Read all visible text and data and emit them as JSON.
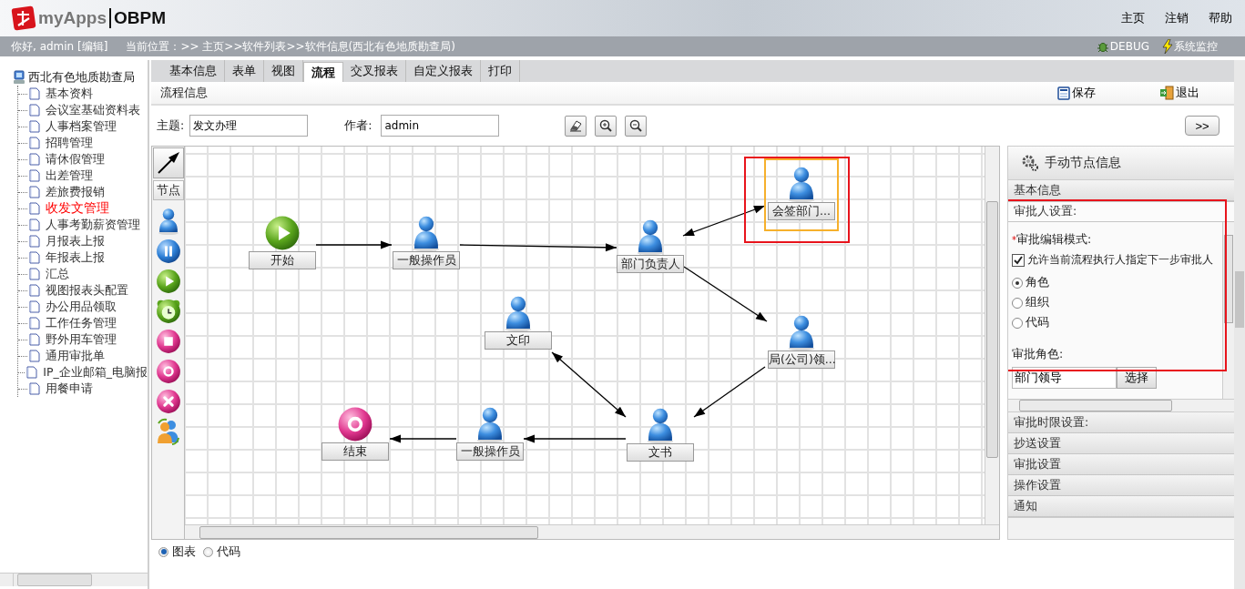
{
  "header": {
    "logo_text": "myApps",
    "product": "OBPM",
    "links": [
      "主页",
      "注销",
      "帮助"
    ]
  },
  "info_bar": {
    "greeting": "你好, admin [编辑]",
    "location": "当前位置：>> 主页>>软件列表>>软件信息(西北有色地质勘查局)",
    "tools": [
      {
        "kind": "debug",
        "label": "DEBUG"
      },
      {
        "kind": "monitor",
        "label": "系统监控"
      }
    ]
  },
  "sidebar": {
    "root": "西北有色地质勘查局",
    "items": [
      {
        "label": "基本资料",
        "selected": false
      },
      {
        "label": "会议室基础资料表",
        "selected": false
      },
      {
        "label": "人事档案管理",
        "selected": false
      },
      {
        "label": "招聘管理",
        "selected": false
      },
      {
        "label": "请休假管理",
        "selected": false
      },
      {
        "label": "出差管理",
        "selected": false
      },
      {
        "label": "差旅费报销",
        "selected": false
      },
      {
        "label": "收发文管理",
        "selected": true
      },
      {
        "label": "人事考勤薪资管理",
        "selected": false
      },
      {
        "label": "月报表上报",
        "selected": false
      },
      {
        "label": "年报表上报",
        "selected": false
      },
      {
        "label": "汇总",
        "selected": false
      },
      {
        "label": "视图报表头配置",
        "selected": false
      },
      {
        "label": "办公用品领取",
        "selected": false
      },
      {
        "label": "工作任务管理",
        "selected": false
      },
      {
        "label": "野外用车管理",
        "selected": false
      },
      {
        "label": "通用审批单",
        "selected": false
      },
      {
        "label": "IP_企业邮箱_电脑报",
        "selected": false
      },
      {
        "label": "用餐申请",
        "selected": false
      }
    ]
  },
  "tabs": [
    {
      "label": "基本信息",
      "selected": false
    },
    {
      "label": "表单",
      "selected": false
    },
    {
      "label": "视图",
      "selected": false
    },
    {
      "label": "流程",
      "selected": true
    },
    {
      "label": "交叉报表",
      "selected": false
    },
    {
      "label": "自定义报表",
      "selected": false
    },
    {
      "label": "打印",
      "selected": false
    }
  ],
  "toolbar": {
    "title": "流程信息",
    "buttons": [
      {
        "kind": "save",
        "label": "保存"
      },
      {
        "kind": "exit",
        "label": "退出"
      }
    ]
  },
  "form": {
    "subject_label": "主题:",
    "subject": "发文办理",
    "author_label": "作者:",
    "author": "admin",
    "expand_button": ">>"
  },
  "palette": {
    "label": "节点",
    "tools": [
      {
        "kind": "person"
      },
      {
        "kind": "suspend"
      },
      {
        "kind": "start"
      },
      {
        "kind": "timer"
      },
      {
        "kind": "stop"
      },
      {
        "kind": "end"
      },
      {
        "kind": "abort"
      },
      {
        "kind": "auto"
      }
    ]
  },
  "diagram": {
    "nodes": [
      {
        "label": "会签部门...",
        "kind": "person",
        "selected": true
      },
      {
        "label": "开始",
        "kind": "start",
        "selected": false
      },
      {
        "label": "一般操作员",
        "kind": "person",
        "selected": false
      },
      {
        "label": "部门负责人",
        "kind": "person",
        "selected": false
      },
      {
        "label": "文印",
        "kind": "person",
        "selected": false
      },
      {
        "label": "局(公司)领...",
        "kind": "person",
        "selected": false
      },
      {
        "label": "结束",
        "kind": "end",
        "selected": false
      },
      {
        "label": "一般操作员",
        "kind": "person",
        "selected": false
      },
      {
        "label": "文书",
        "kind": "person",
        "selected": false
      }
    ]
  },
  "node_panel": {
    "title": "手动节点信息",
    "sections": [
      {
        "label": "基本信息",
        "expanded": false
      },
      {
        "label": "审批人设置:",
        "expanded": true
      },
      {
        "label": "审批时限设置:",
        "expanded": false
      },
      {
        "label": "抄送设置",
        "expanded": false
      },
      {
        "label": "审批设置",
        "expanded": false
      },
      {
        "label": "操作设置",
        "expanded": false
      },
      {
        "label": "通知",
        "expanded": false
      }
    ],
    "approver": {
      "required_mark": "*",
      "mode_label": "审批编辑模式:",
      "allow_label": "允许当前流程执行人指定下一步审批人",
      "allow_checked": true,
      "options": [
        {
          "label": "角色",
          "selected": true
        },
        {
          "label": "组织",
          "selected": false
        },
        {
          "label": "代码",
          "selected": false
        }
      ],
      "role_label": "审批角色:",
      "role_value": "部门领导",
      "select_button": "选择"
    }
  },
  "view_mode": [
    {
      "label": "图表",
      "selected": true
    },
    {
      "label": "代码",
      "selected": false
    }
  ]
}
